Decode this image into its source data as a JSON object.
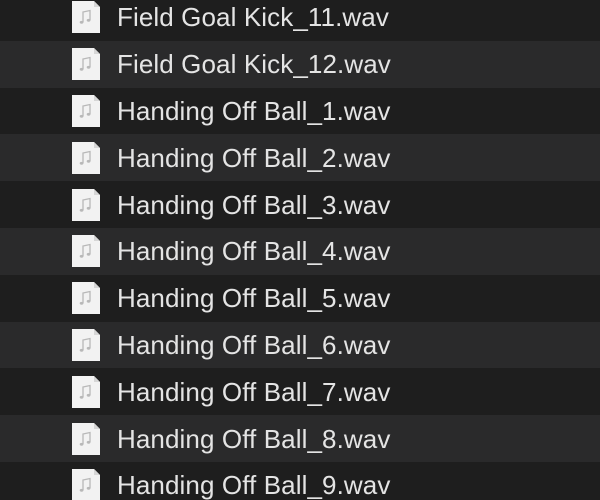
{
  "files": [
    {
      "name": "Field Goal Kick_11.wav",
      "icon": "audio-file-icon"
    },
    {
      "name": "Field Goal Kick_12.wav",
      "icon": "audio-file-icon"
    },
    {
      "name": "Handing Off Ball_1.wav",
      "icon": "audio-file-icon"
    },
    {
      "name": "Handing Off Ball_2.wav",
      "icon": "audio-file-icon"
    },
    {
      "name": "Handing Off Ball_3.wav",
      "icon": "audio-file-icon"
    },
    {
      "name": "Handing Off Ball_4.wav",
      "icon": "audio-file-icon"
    },
    {
      "name": "Handing Off Ball_5.wav",
      "icon": "audio-file-icon"
    },
    {
      "name": "Handing Off Ball_6.wav",
      "icon": "audio-file-icon"
    },
    {
      "name": "Handing Off Ball_7.wav",
      "icon": "audio-file-icon"
    },
    {
      "name": "Handing Off Ball_8.wav",
      "icon": "audio-file-icon"
    },
    {
      "name": "Handing Off Ball_9.wav",
      "icon": "audio-file-icon"
    }
  ],
  "colors": {
    "background": "#1e1e1e",
    "stripe": "#2a2a2b",
    "text": "#e4e4e4",
    "icon_paper": "#f2f2f2",
    "icon_glyph": "#b8b8b8"
  }
}
